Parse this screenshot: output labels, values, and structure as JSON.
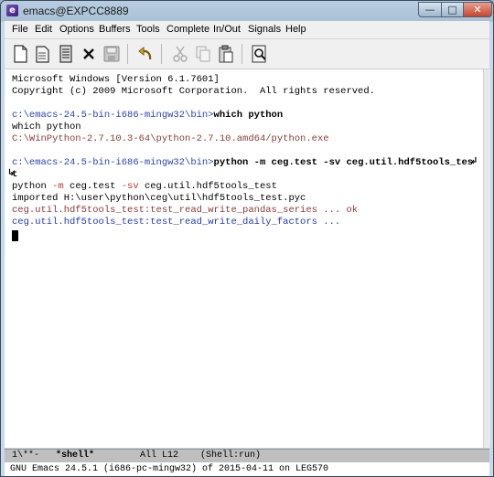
{
  "window": {
    "title": "emacs@EXPCC8889",
    "min": "—",
    "max": "□",
    "close": "✕"
  },
  "menu": [
    "File",
    "Edit",
    "Options",
    "Buffers",
    "Tools",
    "Complete",
    "In/Out",
    "Signals",
    "Help"
  ],
  "toolbar": {
    "buttons": [
      "new-file",
      "open-file",
      "dired",
      "close-buffer",
      "save",
      "undo",
      "cut",
      "copy",
      "paste",
      "search"
    ],
    "close_glyph": "✕"
  },
  "buffer": {
    "l1": "Microsoft Windows [Version 6.1.7601]",
    "l2": "Copyright (c) 2009 Microsoft Corporation.  All rights reserved.",
    "p1": "c:\\emacs-24.5-bin-i686-mingw32\\bin>",
    "c1": "which python",
    "o1": "which python",
    "o2": "C:\\WinPython-2.7.10.3-64\\python-2.7.10.amd64/python.exe",
    "p2": "c:\\emacs-24.5-bin-i686-mingw32\\bin>",
    "c2": "python -m ceg.test -sv ceg.util.hdf5tools_tes",
    "c2_wrap": "t",
    "r1a": "python ",
    "r1b": "-m",
    "r1c": " ceg.test ",
    "r1d": "-sv",
    "r1e": " ceg.util.hdf5tools_test",
    "r2": "imported H:\\user\\python\\ceg\\util\\hdf5tools_test.pyc",
    "r3": "ceg.util.hdf5tools_test:test_read_write_pandas_series ... ok",
    "r4": "ceg.util.hdf5tools_test:test_read_write_daily_factors ...",
    "wrap_right": "↲",
    "wrap_left": "↳"
  },
  "modeline": {
    "status": "1\\**-",
    "buffer": "*shell*",
    "position": "All L12",
    "mode": "(Shell:run)"
  },
  "echo": "GNU Emacs 24.5.1 (i686-pc-mingw32) of 2015-04-11 on LEG570"
}
